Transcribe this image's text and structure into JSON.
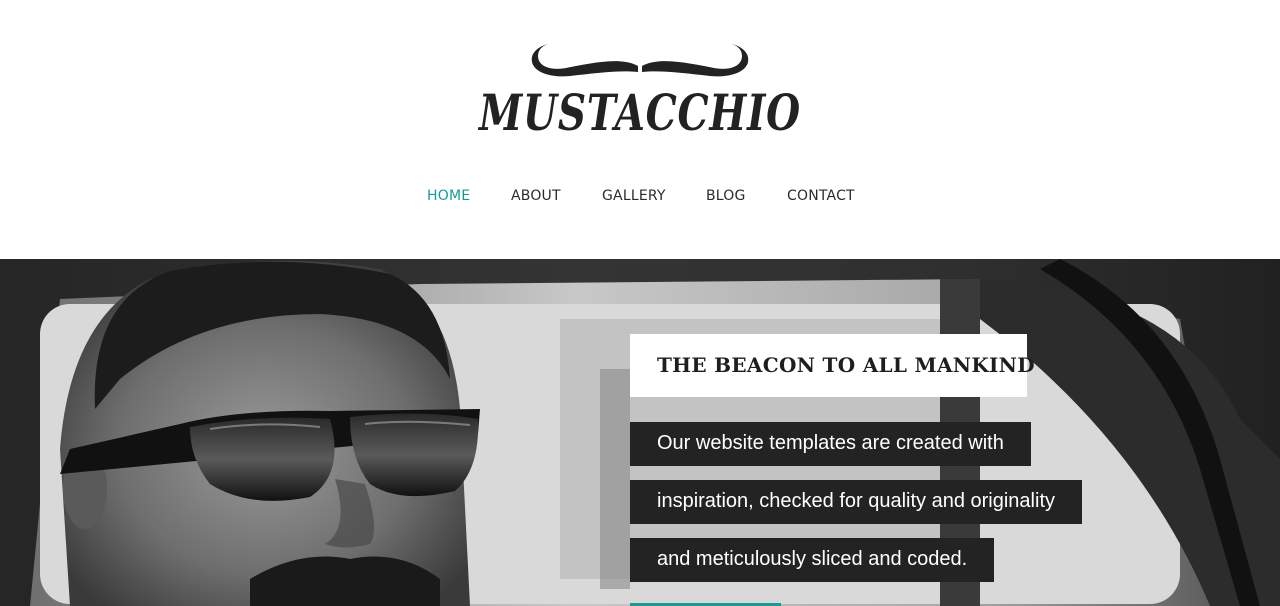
{
  "brand": {
    "name": "MUSTACCHIO",
    "text_color": "#222222"
  },
  "nav": {
    "items": [
      {
        "label": "HOME",
        "active": true
      },
      {
        "label": "ABOUT",
        "active": false
      },
      {
        "label": "GALLERY",
        "active": false
      },
      {
        "label": "BLOG",
        "active": false
      },
      {
        "label": "CONTACT",
        "active": false
      }
    ],
    "active_color": "#199a93",
    "text_color": "#2b2b2b"
  },
  "hero": {
    "title": "THE BEACON TO ALL MANKIND",
    "lines": [
      "Our website templates are created with",
      "inspiration, checked for quality and originality",
      "and meticulously sliced and coded."
    ],
    "button_color": "#199a93",
    "photo": "black-and-white-man-in-sunglasses-driving-car"
  }
}
